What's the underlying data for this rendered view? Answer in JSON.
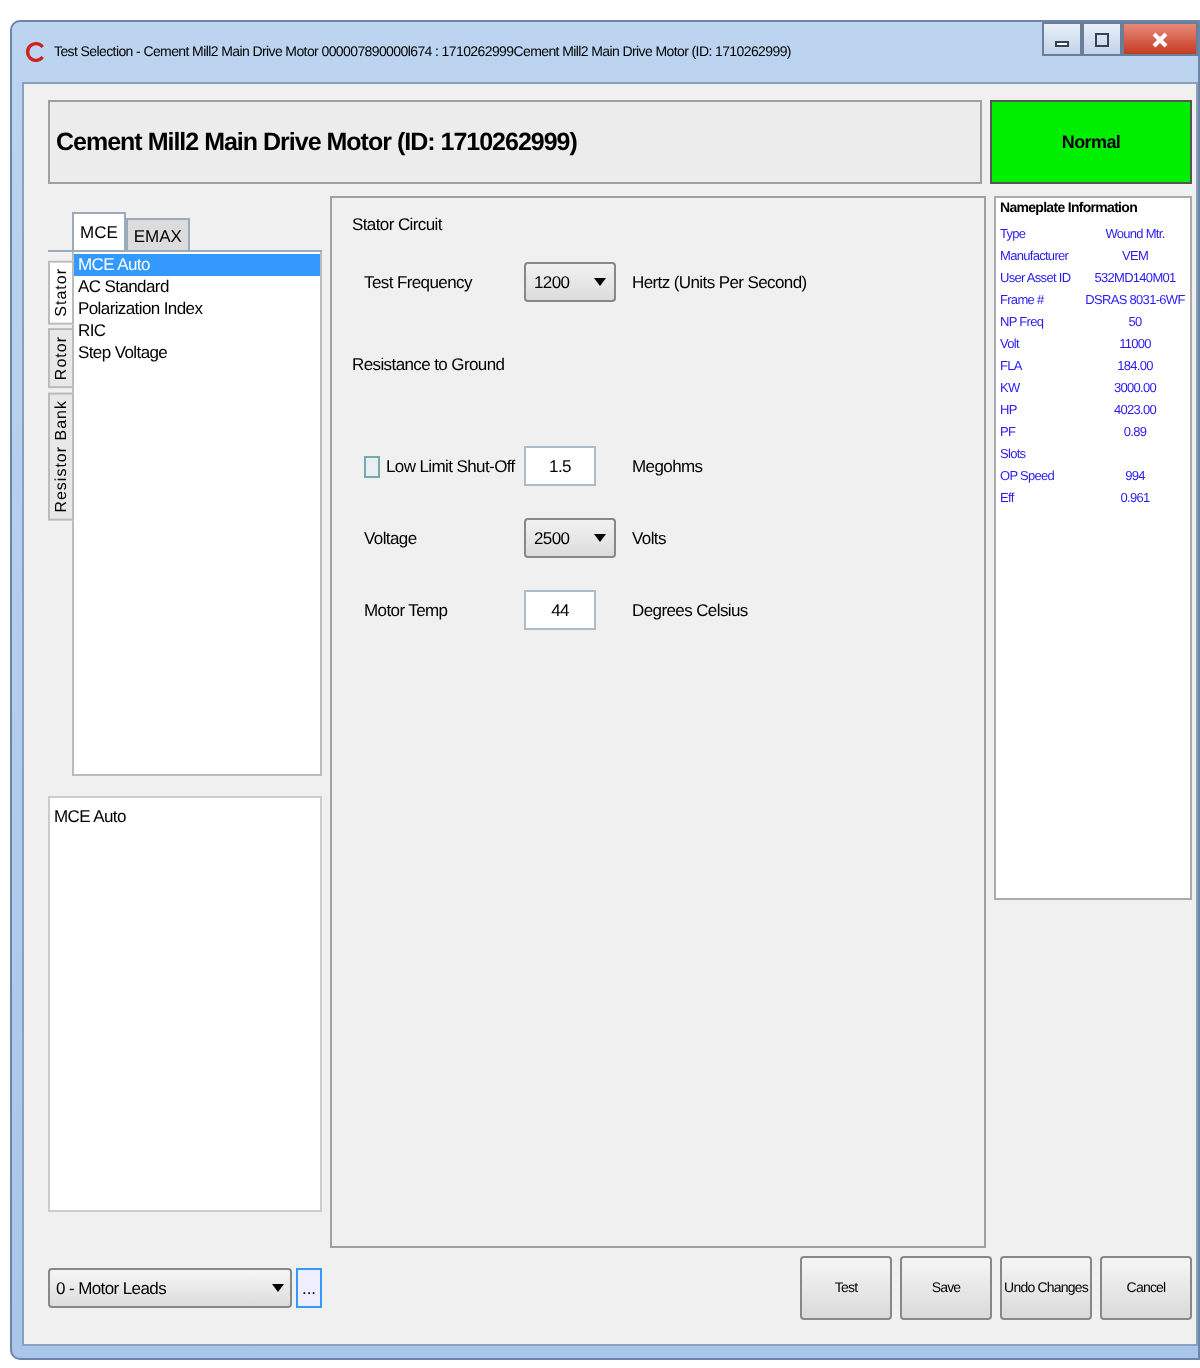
{
  "window": {
    "title": "Test Selection - Cement Mill2 Main Drive Motor  000007890000l674 : 1710262999Cement Mill2 Main Drive Motor  (ID: 1710262999)"
  },
  "header": {
    "title": "Cement Mill2 Main Drive Motor  (ID: 1710262999)",
    "status": "Normal"
  },
  "tabs": [
    {
      "label": "MCE",
      "selected": true
    },
    {
      "label": "EMAX",
      "selected": false
    }
  ],
  "side_tabs": [
    {
      "label": "Stator",
      "selected": true
    },
    {
      "label": "Rotor",
      "selected": false
    },
    {
      "label": "Resistor Bank",
      "selected": false
    }
  ],
  "tests": [
    {
      "label": "MCE Auto",
      "selected": true
    },
    {
      "label": "AC Standard",
      "selected": false
    },
    {
      "label": "Polarization Index",
      "selected": false
    },
    {
      "label": "RIC",
      "selected": false
    },
    {
      "label": "Step Voltage",
      "selected": false
    }
  ],
  "selected_test": "MCE Auto",
  "settings": [
    {
      "kind": "heading",
      "label": "Stator Circuit"
    },
    {
      "kind": "dropdown",
      "label": "Test Frequency",
      "value": "1200",
      "unit": "Hertz (Units Per Second)"
    },
    {
      "kind": "heading",
      "label": "Resistance to Ground"
    },
    {
      "kind": "checkinput",
      "label": "Low Limit Shut-Off",
      "checked": false,
      "value": "1.5",
      "unit": "Megohms"
    },
    {
      "kind": "dropdown",
      "label": "Voltage",
      "value": "2500",
      "unit": "Volts"
    },
    {
      "kind": "input",
      "label": "Motor Temp",
      "value": "44",
      "unit": "Degrees Celsius"
    }
  ],
  "nameplate": {
    "title": "Nameplate Information",
    "rows": [
      {
        "label": "Type",
        "value": "Wound Mtr."
      },
      {
        "label": "Manufacturer",
        "value": "VEM"
      },
      {
        "label": "User Asset ID",
        "value": "532MD140M01"
      },
      {
        "label": "Frame #",
        "value": "DSRAS 8031-6WF"
      },
      {
        "label": "NP Freq",
        "value": "50"
      },
      {
        "label": "Volt",
        "value": "11000"
      },
      {
        "label": "FLA",
        "value": "184.00"
      },
      {
        "label": "KW",
        "value": "3000.00"
      },
      {
        "label": "HP",
        "value": "4023.00"
      },
      {
        "label": "PF",
        "value": "0.89"
      },
      {
        "label": "Slots"
      },
      {
        "label": "OP Speed",
        "value": "994"
      },
      {
        "label": "Eff",
        "value": "0.961"
      }
    ]
  },
  "lead_select": "0 - Motor Leads",
  "browse_button": "...",
  "buttons": [
    "Test",
    "Save",
    "Undo Changes",
    "Cancel"
  ]
}
